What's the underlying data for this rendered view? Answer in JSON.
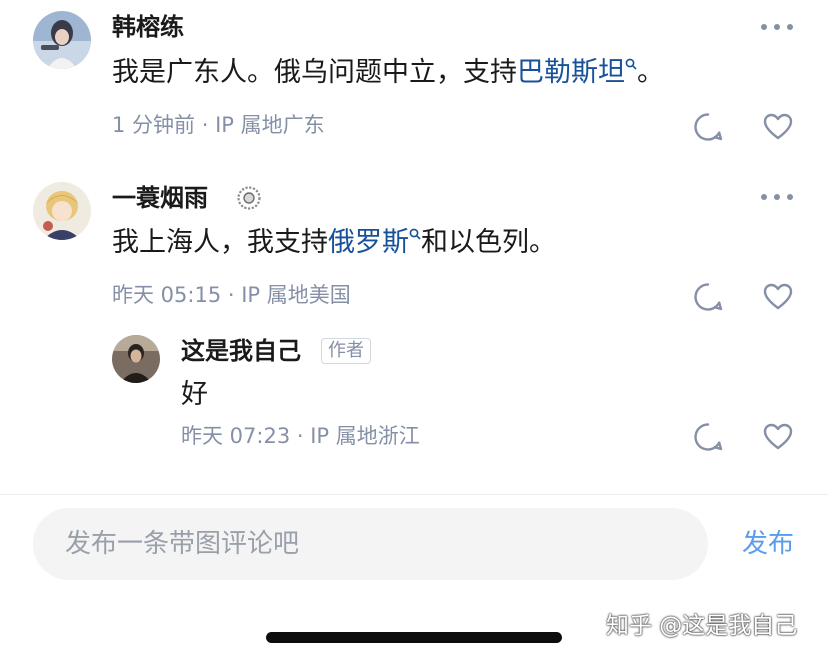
{
  "comments": [
    {
      "author": "韩榕练",
      "body_before": "我是广东人。俄乌问题中立，支持",
      "link_text": "巴勒斯坦",
      "body_after": "。",
      "time": "1 分钟前",
      "sep": " · ",
      "ip": "IP 属地广东"
    },
    {
      "author": "一蓑烟雨",
      "body_before": "我上海人，我支持",
      "link_text": "俄罗斯",
      "body_after": "和以色列。",
      "time": "昨天 05:15",
      "sep": " · ",
      "ip": "IP 属地美国"
    }
  ],
  "reply": {
    "author": "这是我自己",
    "badge": "作者",
    "body": "好",
    "time": "昨天 07:23",
    "sep": " · ",
    "ip": "IP 属地浙江"
  },
  "composer": {
    "placeholder": "发布一条带图评论吧",
    "send_label": "发布"
  },
  "watermark": "知乎 @这是我自己",
  "colors": {
    "link": "#175199",
    "meta": "#8590a6",
    "send": "#5b9dea",
    "input_bg": "#f4f4f4"
  },
  "icons": [
    "more-icon",
    "comment-icon",
    "like-heart-icon",
    "search-link-icon",
    "identity-badge-icon"
  ]
}
